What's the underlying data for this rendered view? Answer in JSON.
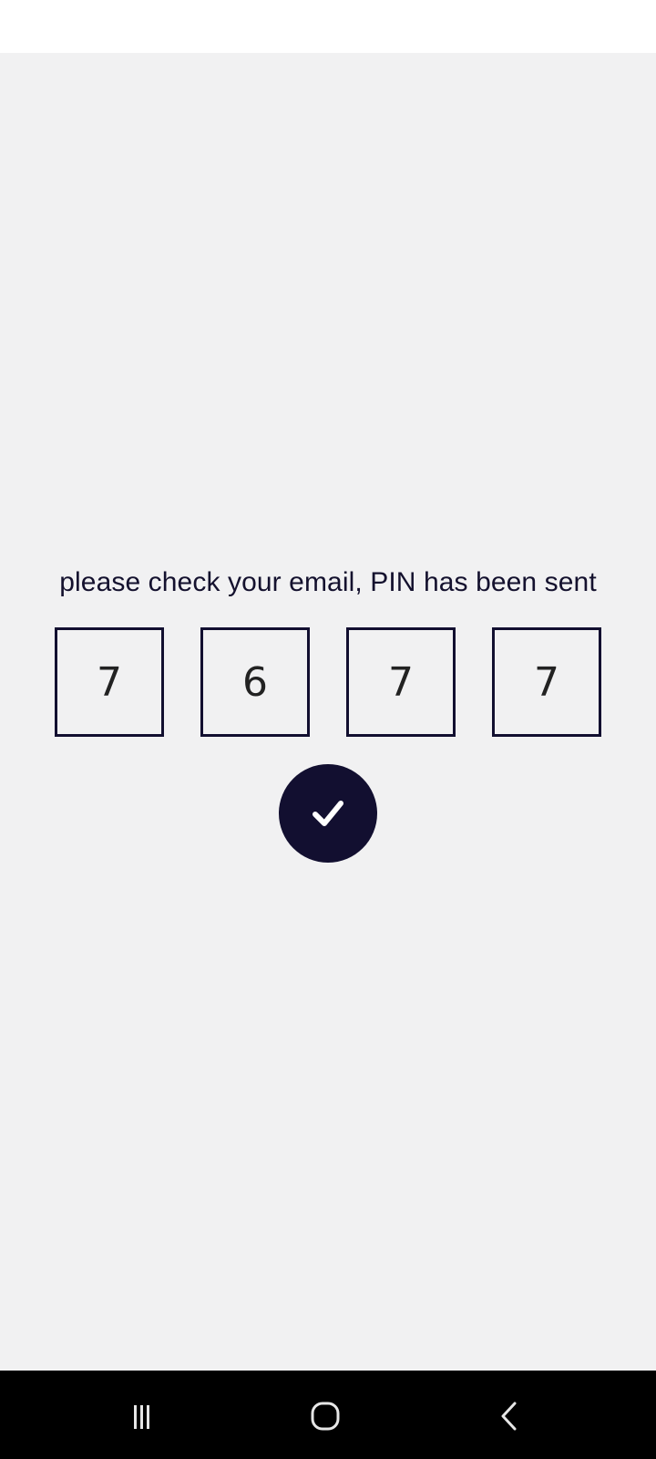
{
  "prompt": {
    "message": "please check your email, PIN has been sent"
  },
  "pin": {
    "digits": [
      "7",
      "6",
      "7",
      "7"
    ]
  },
  "confirm": {
    "icon": "checkmark-icon"
  },
  "navigation": {
    "recents_icon": "recents-icon",
    "home_icon": "home-icon",
    "back_icon": "back-icon"
  },
  "colors": {
    "background": "#f1f1f2",
    "accent": "#120f30",
    "navbar": "#000000"
  }
}
